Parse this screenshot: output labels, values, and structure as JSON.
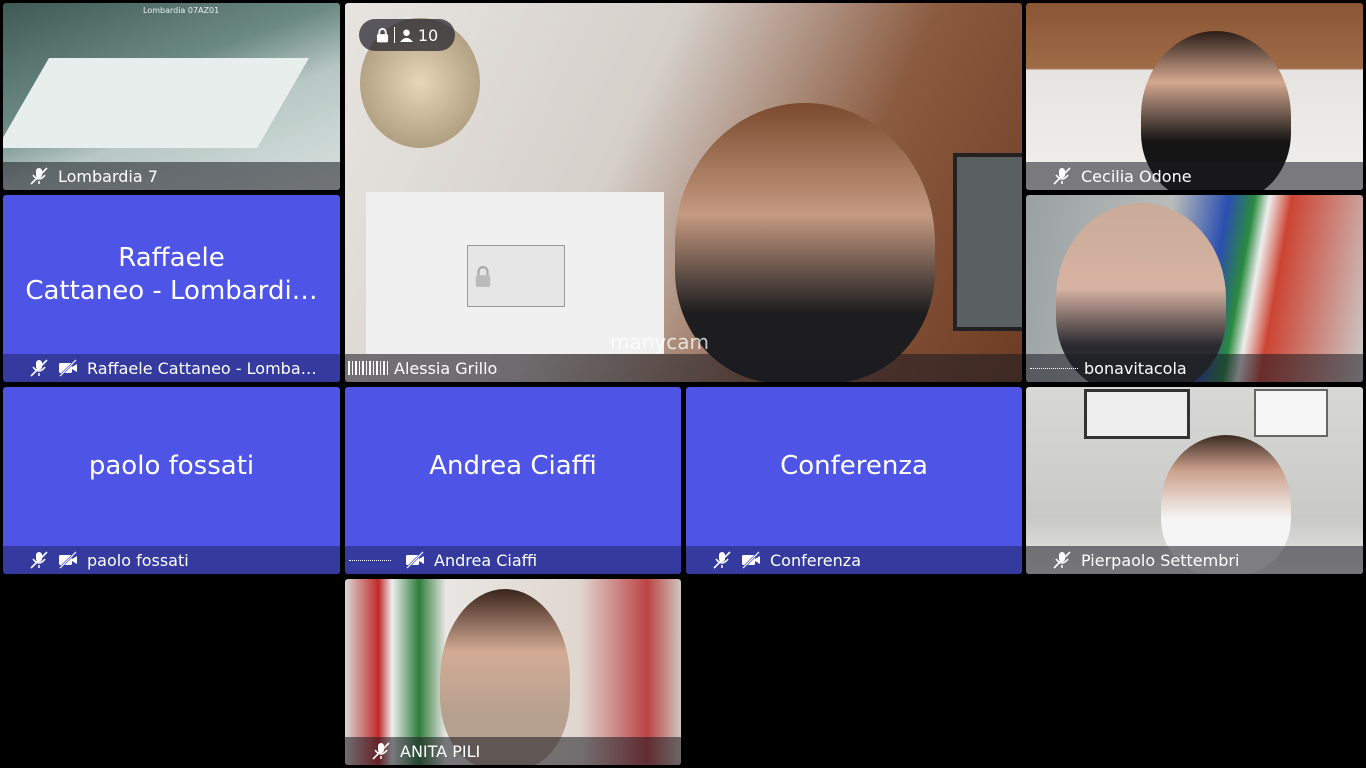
{
  "meeting": {
    "participant_count": "10",
    "lock_icon": "lock-icon",
    "person_icon": "person-icon"
  },
  "tiles": {
    "lombardia": {
      "name": "Lombardia 7",
      "room_label": "Lombardia 07AZ01"
    },
    "main": {
      "name": "Alessia Grillo",
      "watermark": "manycam"
    },
    "cecilia": {
      "name": "Cecilia Odone"
    },
    "raffaele": {
      "display_line1": "Raffaele",
      "display_line2": "Cattaneo - Lombardi…",
      "name": "Raffaele Cattaneo - Lomba…"
    },
    "bonavitacola": {
      "name": "bonavitacola"
    },
    "paolo": {
      "display": "paolo fossati",
      "name": "paolo fossati"
    },
    "andrea": {
      "display": "Andrea Ciaffi",
      "name": "Andrea Ciaffi"
    },
    "conferenza": {
      "display": "Conferenza",
      "name": "Conferenza"
    },
    "pierpaolo": {
      "name": "Pierpaolo Settembri"
    },
    "anita": {
      "name": "ANITA PILI"
    }
  },
  "colors": {
    "placeholder_bg": "#4e55e6",
    "background": "#000000"
  }
}
